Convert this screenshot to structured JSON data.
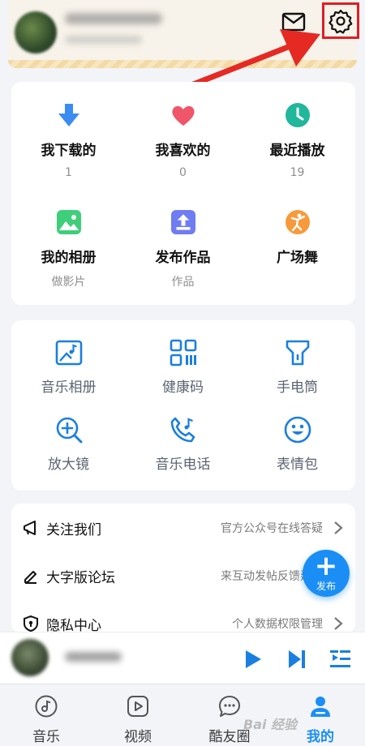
{
  "header": {
    "mail_icon": "mail-icon",
    "settings_icon": "gear-icon",
    "highlight_color": "#e01e25"
  },
  "quick_grid": [
    {
      "label": "我下载的",
      "sub": "1",
      "icon": "download-arrow-icon",
      "color": "#3b8cf0"
    },
    {
      "label": "我喜欢的",
      "sub": "0",
      "icon": "heart-icon",
      "color": "#f0566a"
    },
    {
      "label": "最近播放",
      "sub": "19",
      "icon": "clock-icon",
      "color": "#21b79a"
    },
    {
      "label": "我的相册",
      "sub": "做影片",
      "icon": "photo-icon",
      "color": "#3fcf7a"
    },
    {
      "label": "发布作品",
      "sub": "作品",
      "icon": "upload-icon",
      "color": "#6f7cf2"
    },
    {
      "label": "广场舞",
      "sub": "",
      "icon": "dancer-icon",
      "color": "#f79a3b"
    }
  ],
  "tools_grid": [
    {
      "label": "音乐相册",
      "icon": "music-album-icon"
    },
    {
      "label": "健康码",
      "icon": "qr-code-icon"
    },
    {
      "label": "手电筒",
      "icon": "flashlight-icon"
    },
    {
      "label": "放大镜",
      "icon": "magnifier-icon"
    },
    {
      "label": "音乐电话",
      "icon": "phone-music-icon"
    },
    {
      "label": "表情包",
      "icon": "smiley-icon"
    }
  ],
  "menu_list": [
    {
      "title": "关注我们",
      "desc": "官方公众号在线答疑",
      "icon": "megaphone-icon"
    },
    {
      "title": "大字版论坛",
      "desc": "来互动发帖反馈建议",
      "icon": "pen-icon"
    },
    {
      "title": "隐私中心",
      "desc": "个人数据权限管理",
      "icon": "shield-icon"
    }
  ],
  "fab": {
    "label": "发布",
    "icon": "plus-icon"
  },
  "player": {
    "controls": [
      "play-icon",
      "next-track-icon",
      "playlist-icon"
    ]
  },
  "tabs": [
    {
      "label": "音乐",
      "icon": "music-note-icon",
      "active": false
    },
    {
      "label": "视频",
      "icon": "video-play-icon",
      "active": false
    },
    {
      "label": "酷友圈",
      "icon": "chat-bubble-icon",
      "active": false
    },
    {
      "label": "我的",
      "icon": "user-icon",
      "active": true
    }
  ],
  "accent_color": "#1a8ef5",
  "watermark": "Bai 经验"
}
